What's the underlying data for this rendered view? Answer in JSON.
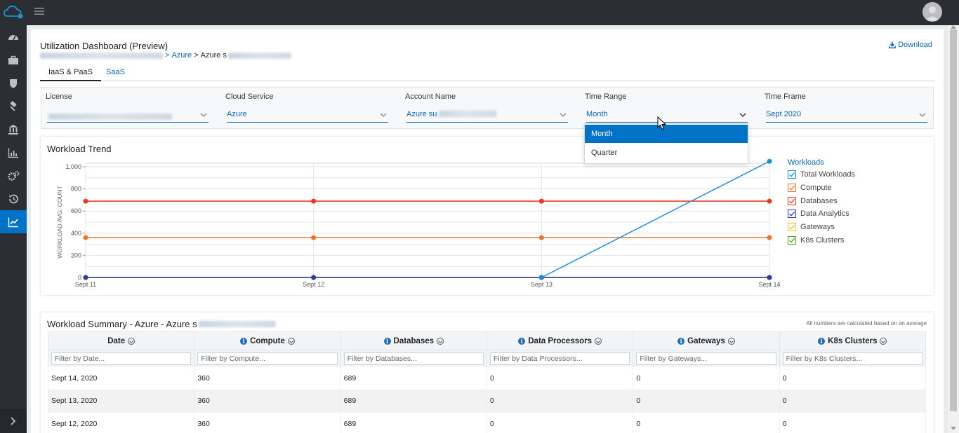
{
  "topbar": {
    "logo_icon": "cloud-logo-icon",
    "menu_icon": "hamburger-icon"
  },
  "sidebar": {
    "items": [
      {
        "icon": "dashboard-icon",
        "active": false
      },
      {
        "icon": "briefcase-icon",
        "active": false
      },
      {
        "icon": "shield-icon",
        "active": false
      },
      {
        "icon": "hammer-icon",
        "active": false
      },
      {
        "icon": "bank-icon",
        "active": false
      },
      {
        "icon": "bar-chart-icon",
        "active": false
      },
      {
        "icon": "gears-icon",
        "active": false
      },
      {
        "icon": "history-icon",
        "active": false
      },
      {
        "icon": "line-chart-icon",
        "active": true
      }
    ],
    "expand_icon": "chevron-right-icon"
  },
  "page": {
    "title": "Utilization Dashboard (Preview)",
    "breadcrumb": {
      "sep1": ">",
      "service": "Azure",
      "sep2": ">",
      "account": "Azure s"
    },
    "download_label": "Download"
  },
  "tabs": [
    {
      "label": "IaaS & PaaS",
      "active": true
    },
    {
      "label": "SaaS",
      "active": false
    }
  ],
  "filters": {
    "license": {
      "label": "License",
      "value": ""
    },
    "cloud_service": {
      "label": "Cloud Service",
      "value": "Azure"
    },
    "account_name": {
      "label": "Account Name",
      "value": "Azure su"
    },
    "time_range": {
      "label": "Time Range",
      "value": "Month",
      "options": [
        "Month",
        "Quarter"
      ]
    },
    "time_frame": {
      "label": "Time Frame",
      "value": "Sept 2020"
    }
  },
  "trend": {
    "title": "Workload Trend",
    "legend_title": "Workloads"
  },
  "chart_data": {
    "type": "line",
    "title": "Workload Trend",
    "xlabel": "",
    "ylabel": "WORKLOAD AVG. COUNT",
    "categories": [
      "Sept 11",
      "Sept 12",
      "Sept 13",
      "Sept 14"
    ],
    "y_ticks": [
      "1,000",
      "800",
      "600",
      "400",
      "200",
      "0"
    ],
    "ylim": [
      0,
      1000
    ],
    "grid": true,
    "legend_position": "right",
    "series": [
      {
        "name": "Total Workloads",
        "color": "#1a8fd8",
        "values": [
          null,
          null,
          0,
          1049
        ]
      },
      {
        "name": "Compute",
        "color": "#e8762b",
        "values": [
          360,
          360,
          360,
          360
        ]
      },
      {
        "name": "Databases",
        "color": "#e8391e",
        "values": [
          689,
          689,
          689,
          689
        ]
      },
      {
        "name": "Data Analytics",
        "color": "#2a3f9a",
        "values": [
          0,
          0,
          0,
          0
        ]
      },
      {
        "name": "Gateways",
        "color": "#f0c02c",
        "values": [
          0,
          0,
          0,
          0
        ]
      },
      {
        "name": "K8s Clusters",
        "color": "#4c9a2a",
        "values": [
          0,
          0,
          0,
          0
        ]
      }
    ]
  },
  "summary": {
    "title": "Workload Summary - Azure - Azure s",
    "note": "All numbers are calculated based on an average",
    "columns": [
      {
        "label": "Date",
        "info": false,
        "placeholder": "Filter by Date..."
      },
      {
        "label": "Compute",
        "info": true,
        "placeholder": "Filter by Compute..."
      },
      {
        "label": "Databases",
        "info": true,
        "placeholder": "Filter by Databases..."
      },
      {
        "label": "Data Processors",
        "info": true,
        "placeholder": "Filter by Data Processors..."
      },
      {
        "label": "Gateways",
        "info": true,
        "placeholder": "Filter by Gateways..."
      },
      {
        "label": "K8s Clusters",
        "info": true,
        "placeholder": "Filter by K8s Clusters..."
      }
    ],
    "rows": [
      [
        "Sept 14, 2020",
        "360",
        "689",
        "0",
        "0",
        "0"
      ],
      [
        "Sept 13, 2020",
        "360",
        "689",
        "0",
        "0",
        "0"
      ],
      [
        "Sept 12, 2020",
        "360",
        "689",
        "0",
        "0",
        "0"
      ]
    ]
  }
}
